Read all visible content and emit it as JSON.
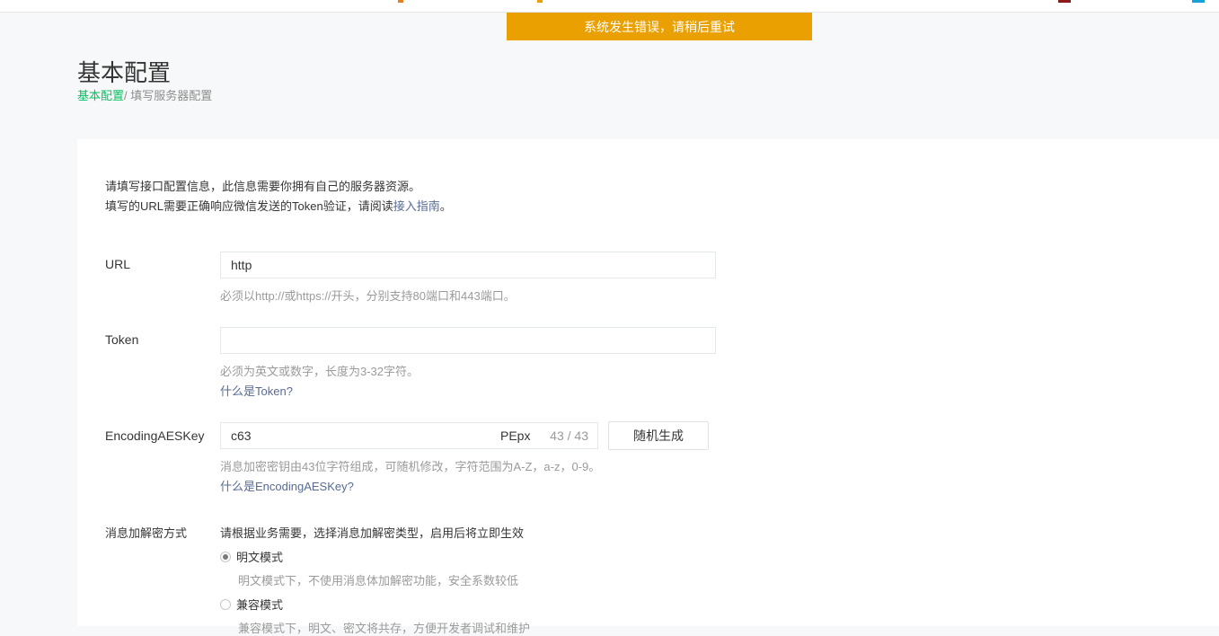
{
  "toast": {
    "message": "系统发生错误，请稍后重试"
  },
  "header": {
    "title": "基本配置",
    "breadcrumb": {
      "root": "基本配置",
      "separator": "/ ",
      "current": "填写服务器配置"
    }
  },
  "intro": {
    "line1": "请填写接口配置信息，此信息需要你拥有自己的服务器资源。",
    "line2_prefix": "填写的URL需要正确响应微信发送的Token验证，请阅读",
    "line2_link": "接入指南",
    "line2_suffix": "。"
  },
  "form": {
    "url": {
      "label": "URL",
      "value": "http",
      "hint": "必须以http://或https://开头，分别支持80端口和443端口。"
    },
    "token": {
      "label": "Token",
      "value": "",
      "hint": "必须为英文或数字，长度为3-32字符。",
      "help_link": "什么是Token?"
    },
    "aes_key": {
      "label": "EncodingAESKey",
      "value_start": "c63",
      "value_end": "PEpx",
      "counter": "43 / 43",
      "generate_button": "随机生成",
      "hint": "消息加密密钥由43位字符组成，可随机修改，字符范围为A-Z，a-z，0-9。",
      "help_link": "什么是EncodingAESKey?"
    },
    "encryption": {
      "label": "消息加解密方式",
      "description": "请根据业务需要，选择消息加解密类型，启用后将立即生效",
      "options": [
        {
          "label": "明文模式",
          "description": "明文模式下，不使用消息体加解密功能，安全系数较低",
          "checked": true
        },
        {
          "label": "兼容模式",
          "description": "兼容模式下，明文、密文将共存，方便开发者调试和维护",
          "checked": false
        }
      ]
    }
  },
  "colors": {
    "accent_green": "#07c160",
    "link_blue": "#576b95",
    "toast_orange": "#e9a000"
  }
}
